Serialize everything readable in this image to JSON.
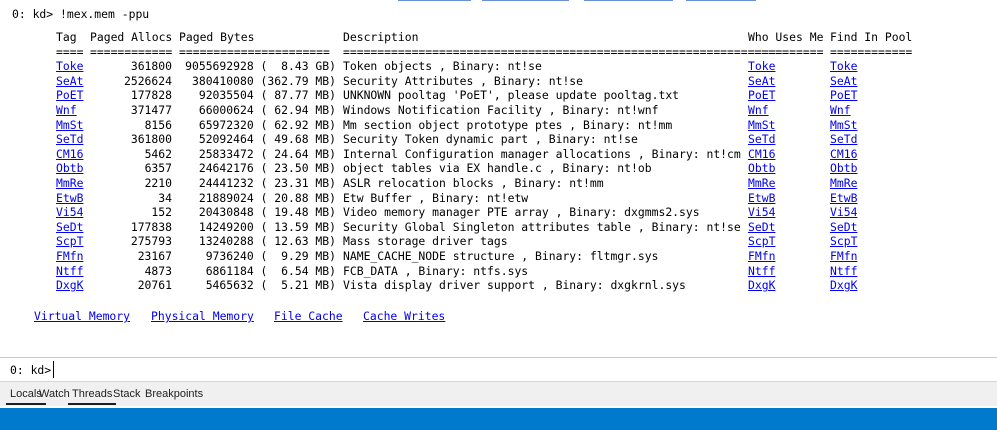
{
  "command_echo": "0: kd> !mex.mem -ppu",
  "table": {
    "headers": [
      "Tag",
      "Paged Allocs",
      "Paged Bytes",
      "Description",
      "Who Uses Me",
      "Find In Pool"
    ],
    "separators": [
      "====",
      "============",
      "======================",
      "=================================================================",
      "===========",
      "============"
    ],
    "rows": [
      {
        "tag": "Toke",
        "allocs": "361800",
        "bytes": "9055692928 (  8.43 GB)",
        "desc": "Token objects , Binary: nt!se",
        "who": "Toke",
        "find": "Toke"
      },
      {
        "tag": "SeAt",
        "allocs": "2526624",
        "bytes": "380410080 (362.79 MB)",
        "desc": "Security Attributes , Binary: nt!se",
        "who": "SeAt",
        "find": "SeAt"
      },
      {
        "tag": "PoET",
        "allocs": "177828",
        "bytes": "92035504 ( 87.77 MB)",
        "desc": "UNKNOWN pooltag 'PoET', please update pooltag.txt",
        "who": "PoET",
        "find": "PoET"
      },
      {
        "tag": "Wnf",
        "allocs": "371477",
        "bytes": "66000624 ( 62.94 MB)",
        "desc": "Windows Notification Facility , Binary: nt!wnf",
        "who": "Wnf",
        "find": "Wnf"
      },
      {
        "tag": "MmSt",
        "allocs": "8156",
        "bytes": "65972320 ( 62.92 MB)",
        "desc": "Mm section object prototype ptes , Binary: nt!mm",
        "who": "MmSt",
        "find": "MmSt"
      },
      {
        "tag": "SeTd",
        "allocs": "361800",
        "bytes": "52092464 ( 49.68 MB)",
        "desc": "Security Token dynamic part , Binary: nt!se",
        "who": "SeTd",
        "find": "SeTd"
      },
      {
        "tag": "CM16",
        "allocs": "5462",
        "bytes": "25833472 ( 24.64 MB)",
        "desc": "Internal Configuration manager allocations , Binary: nt!cm",
        "who": "CM16",
        "find": "CM16"
      },
      {
        "tag": "Obtb",
        "allocs": "6357",
        "bytes": "24642176 ( 23.50 MB)",
        "desc": "object tables via EX handle.c , Binary: nt!ob",
        "who": "Obtb",
        "find": "Obtb"
      },
      {
        "tag": "MmRe",
        "allocs": "2210",
        "bytes": "24441232 ( 23.31 MB)",
        "desc": "ASLR relocation blocks , Binary: nt!mm",
        "who": "MmRe",
        "find": "MmRe"
      },
      {
        "tag": "EtwB",
        "allocs": "34",
        "bytes": "21889024 ( 20.88 MB)",
        "desc": "Etw Buffer , Binary: nt!etw",
        "who": "EtwB",
        "find": "EtwB"
      },
      {
        "tag": "Vi54",
        "allocs": "152",
        "bytes": "20430848 ( 19.48 MB)",
        "desc": "Video memory manager PTE array , Binary: dxgmms2.sys",
        "who": "Vi54",
        "find": "Vi54"
      },
      {
        "tag": "SeDt",
        "allocs": "177838",
        "bytes": "14249200 ( 13.59 MB)",
        "desc": "Security Global Singleton attributes table , Binary: nt!se",
        "who": "SeDt",
        "find": "SeDt"
      },
      {
        "tag": "ScpT",
        "allocs": "275793",
        "bytes": "13240288 ( 12.63 MB)",
        "desc": "Mass storage driver tags",
        "who": "ScpT",
        "find": "ScpT"
      },
      {
        "tag": "FMfn",
        "allocs": "23167",
        "bytes": "9736240 (  9.29 MB)",
        "desc": "NAME_CACHE_NODE structure , Binary: fltmgr.sys",
        "who": "FMfn",
        "find": "FMfn"
      },
      {
        "tag": "Ntff",
        "allocs": "4873",
        "bytes": "6861184 (  6.54 MB)",
        "desc": "FCB_DATA , Binary: ntfs.sys",
        "who": "Ntff",
        "find": "Ntff"
      },
      {
        "tag": "DxgK",
        "allocs": "20761",
        "bytes": "5465632 (  5.21 MB)",
        "desc": "Vista display driver support , Binary: dxgkrnl.sys",
        "who": "DxgK",
        "find": "DxgK"
      }
    ]
  },
  "bottom_links": [
    "Virtual Memory",
    "Physical Memory",
    "File Cache",
    "Cache Writes"
  ],
  "command_bar": {
    "prompt": "0: kd>",
    "value": ""
  },
  "tabs": [
    "Locals",
    "Watch",
    "Threads",
    "Stack",
    "Breakpoints"
  ],
  "colors": {
    "link": "#0000ee",
    "status_bar": "#007acc",
    "top_rule": "#6a8fd8"
  }
}
